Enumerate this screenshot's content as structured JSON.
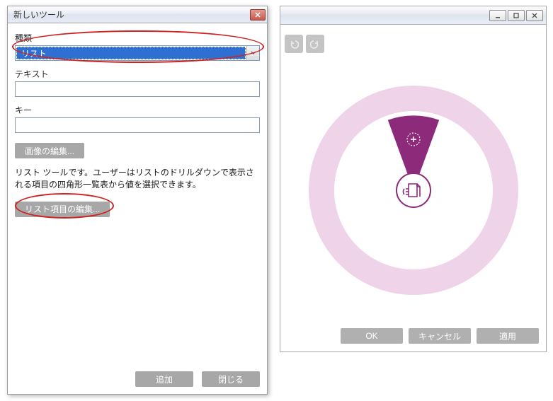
{
  "dialog": {
    "title": "新しいツール",
    "labels": {
      "type": "種類",
      "text": "テキスト",
      "key": "キー"
    },
    "type_select": {
      "value": "リスト"
    },
    "text_value": "",
    "key_value": "",
    "buttons": {
      "edit_image": "画像の編集...",
      "edit_list_items": "リスト項目の編集..."
    },
    "description": "リスト ツールです。ユーザーはリストのドリルダウンで表示される項目の四角形一覧表から値を選択できます。",
    "footer": {
      "add": "追加",
      "close": "閉じる"
    }
  },
  "preview": {
    "footer": {
      "ok": "OK",
      "cancel": "キャンセル",
      "apply": "適用"
    }
  },
  "colors": {
    "accent": "#8e2a7a",
    "ring": "#efd4e9",
    "highlight": "#d02020"
  }
}
